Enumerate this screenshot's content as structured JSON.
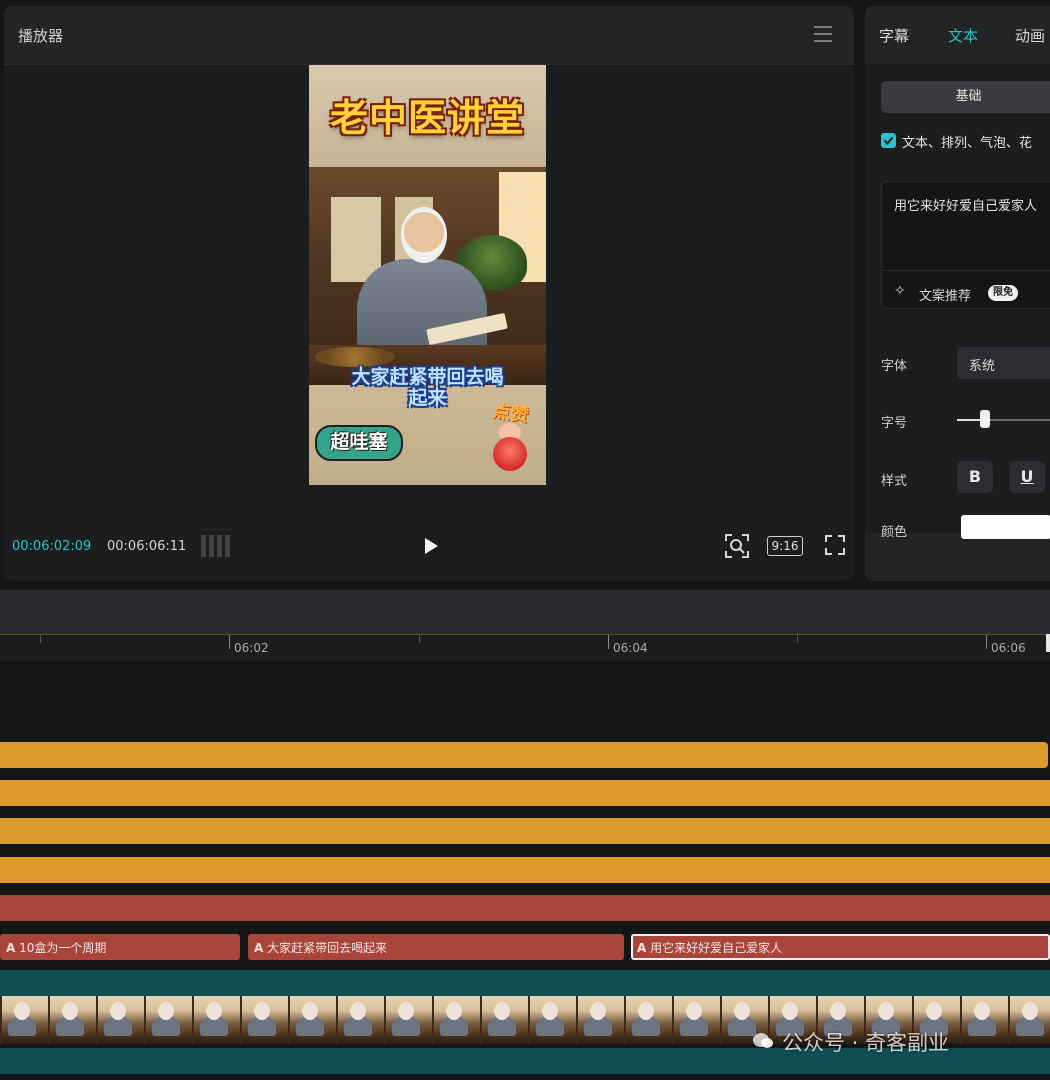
{
  "player": {
    "title": "播放器",
    "preview": {
      "title": "老中医讲堂",
      "caption_line1": "大家赶紧带回去喝",
      "caption_line2": "起来",
      "sticker_left": "超哇塞",
      "sticker_right": "点赞"
    },
    "time_current": "00:06:02:09",
    "time_total": "00:06:06:11",
    "aspect_ratio": "9:16"
  },
  "inspector": {
    "tabs": [
      "字幕",
      "文本",
      "动画"
    ],
    "active_tab": "文本",
    "basic_button": "基础",
    "apply_label": "文本、排列、气泡、花",
    "text_value": "用它来好好爱自己爱家人",
    "suggest_label": "文案推荐",
    "suggest_badge": "限免",
    "font_label": "字体",
    "font_value": "系统",
    "size_label": "字号",
    "size_level": 0.28,
    "style_label": "样式",
    "bold": "B",
    "underline": "U",
    "color_label": "颜色",
    "text_color": "#ffffff"
  },
  "timeline": {
    "ruler_labels": [
      "06:02",
      "06:04",
      "06:06"
    ],
    "subtitle_clips": [
      {
        "label": "10盒为一个周期",
        "icon": "A"
      },
      {
        "label": "大家赶紧带回去喝起来",
        "icon": "A"
      },
      {
        "label": "用它来好好爱自己爱家人",
        "icon": "A"
      }
    ],
    "colors": {
      "gold": "#dc9a2c",
      "rust": "#a8443a",
      "teal": "#0f4f54",
      "accent": "#2fc0c8"
    }
  },
  "watermark": "公众号 · 奇客副业"
}
